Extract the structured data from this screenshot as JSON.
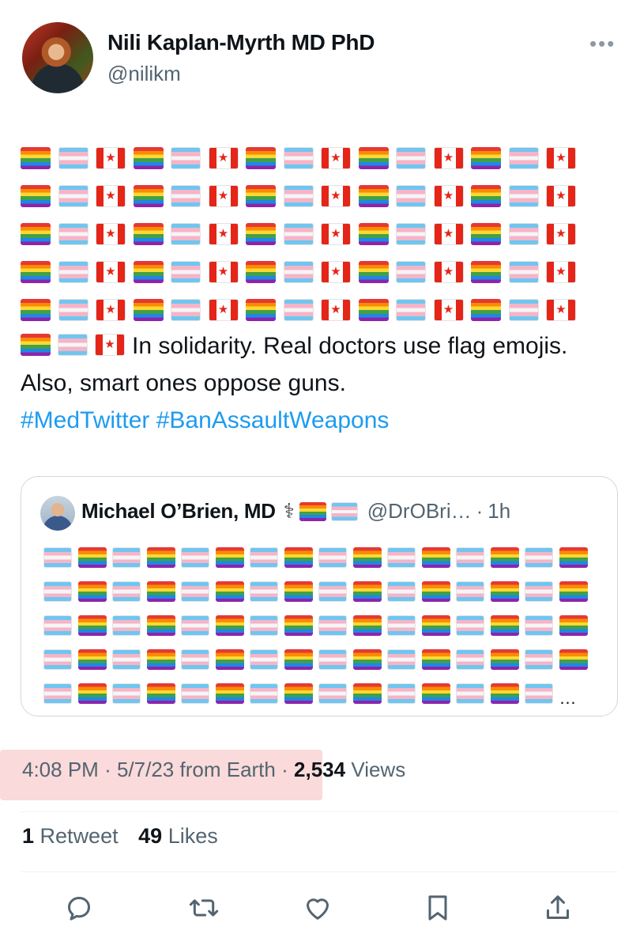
{
  "author": {
    "name": "Nili Kaplan-Myrth MD PhD",
    "handle": "@nilikm"
  },
  "tweet": {
    "flag_rows": [
      [
        "rainbow",
        "trans",
        "canada",
        "rainbow",
        "trans",
        "canada",
        "rainbow",
        "trans",
        "canada",
        "rainbow",
        "trans",
        "canada",
        "rainbow",
        "trans",
        "canada"
      ],
      [
        "rainbow",
        "trans",
        "canada",
        "rainbow",
        "trans",
        "canada",
        "rainbow",
        "trans",
        "canada",
        "rainbow",
        "trans",
        "canada",
        "rainbow",
        "trans",
        "canada"
      ],
      [
        "rainbow",
        "trans",
        "canada",
        "rainbow",
        "trans",
        "canada",
        "rainbow",
        "trans",
        "canada",
        "rainbow",
        "trans",
        "canada",
        "rainbow",
        "trans",
        "canada"
      ],
      [
        "rainbow",
        "trans",
        "canada",
        "rainbow",
        "trans",
        "canada",
        "rainbow",
        "trans",
        "canada",
        "rainbow",
        "trans",
        "canada",
        "rainbow",
        "trans",
        "canada"
      ],
      [
        "rainbow",
        "trans",
        "canada",
        "rainbow",
        "trans",
        "canada",
        "rainbow",
        "trans",
        "canada",
        "rainbow",
        "trans",
        "canada",
        "rainbow",
        "trans",
        "canada"
      ]
    ],
    "lead_flags": [
      "rainbow",
      "trans",
      "canada"
    ],
    "text": "In solidarity. Real doctors use flag emojis. Also, smart ones oppose guns.",
    "hashtags": [
      "#MedTwitter",
      "#BanAssaultWeapons"
    ]
  },
  "quote": {
    "name": "Michael O’Brien, MD",
    "badge_icons": [
      "stethoscope-icon",
      "rainbow-flag-icon",
      "trans-flag-icon"
    ],
    "stethoscope_glyph": "⚕",
    "handle": "@DrOBri…",
    "separator": "·",
    "time": "1h",
    "ellipsis": "…",
    "flag_rows": [
      [
        "trans",
        "rainbow",
        "trans",
        "rainbow",
        "trans",
        "rainbow",
        "trans",
        "rainbow",
        "trans",
        "rainbow",
        "trans",
        "rainbow",
        "trans",
        "rainbow",
        "trans",
        "rainbow"
      ],
      [
        "trans",
        "rainbow",
        "trans",
        "rainbow",
        "trans",
        "rainbow",
        "trans",
        "rainbow",
        "trans",
        "rainbow",
        "trans",
        "rainbow",
        "trans",
        "rainbow",
        "trans",
        "rainbow"
      ],
      [
        "trans",
        "rainbow",
        "trans",
        "rainbow",
        "trans",
        "rainbow",
        "trans",
        "rainbow",
        "trans",
        "rainbow",
        "trans",
        "rainbow",
        "trans",
        "rainbow",
        "trans",
        "rainbow"
      ],
      [
        "trans",
        "rainbow",
        "trans",
        "rainbow",
        "trans",
        "rainbow",
        "trans",
        "rainbow",
        "trans",
        "rainbow",
        "trans",
        "rainbow",
        "trans",
        "rainbow",
        "trans",
        "rainbow"
      ],
      [
        "trans",
        "rainbow",
        "trans",
        "rainbow",
        "trans",
        "rainbow",
        "trans",
        "rainbow",
        "trans",
        "rainbow",
        "trans",
        "rainbow",
        "trans",
        "rainbow",
        "trans"
      ]
    ]
  },
  "meta": {
    "time": "4:08 PM",
    "date": "5/7/23",
    "source": "from Earth",
    "views_count": "2,534",
    "views_label": "Views",
    "sep": "·"
  },
  "stats": {
    "retweets_count": "1",
    "retweets_label": "Retweet",
    "likes_count": "49",
    "likes_label": "Likes"
  },
  "colors": {
    "link": "#1d9bf0",
    "secondary_text": "#536471",
    "highlight": "#fadada",
    "border": "#cfd9de"
  },
  "actions": [
    "reply-icon",
    "retweet-icon",
    "like-icon",
    "bookmark-icon",
    "share-icon"
  ]
}
